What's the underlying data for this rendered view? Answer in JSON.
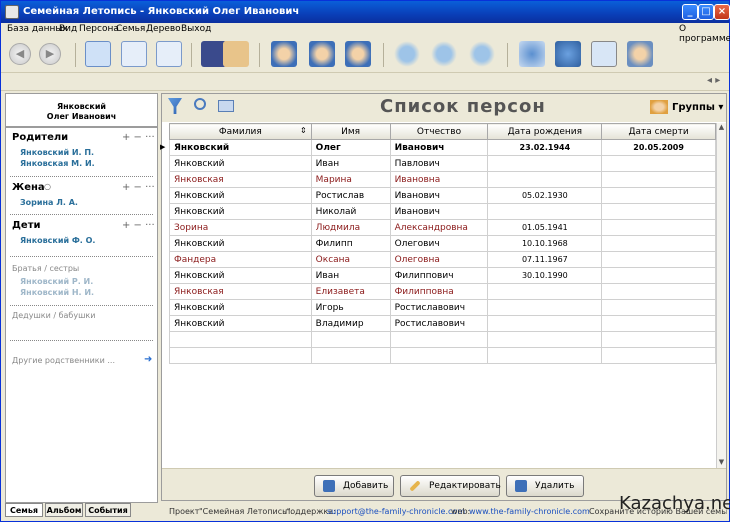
{
  "window": {
    "title": "Семейная Летопись - Янковский Олег Иванович"
  },
  "menu": [
    "База данных",
    "Вид",
    "Персона",
    "Семья",
    "Дерево",
    "Выход"
  ],
  "menu_about": "О программе",
  "left": {
    "person_name": "Янковский",
    "person_given": "Олег Иванович",
    "parents_label": "Родители",
    "parents": [
      "Янковский И. П.",
      "Янковская М. И."
    ],
    "wife_label": "Жена",
    "wife": [
      "Зорина Л. А."
    ],
    "children_label": "Дети",
    "children": [
      "Янковский Ф. О."
    ],
    "siblings_label": "Братья / сестры",
    "siblings": [
      "Янковский Р. И.",
      "Янковский Н. И."
    ],
    "grandparents_label": "Дедушки / бабушки",
    "other_label": "Другие родственники ...",
    "tabs": [
      "Семья",
      "Альбом",
      "События"
    ]
  },
  "main": {
    "title": "Список  персон",
    "groups_label": "Группы",
    "columns": [
      "Фамилия",
      "Имя",
      "Отчество",
      "Дата рождения",
      "Дата смерти"
    ],
    "rows": [
      [
        "Янковский",
        "Олег",
        "Иванович",
        "23.02.1944",
        "20.05.2009"
      ],
      [
        "Янковский",
        "Иван",
        "Павлович",
        "",
        ""
      ],
      [
        "Янковская",
        "Марина",
        "Ивановна",
        "",
        ""
      ],
      [
        "Янковский",
        "Ростислав",
        "Иванович",
        "05.02.1930",
        ""
      ],
      [
        "Янковский",
        "Николай",
        "Иванович",
        "",
        ""
      ],
      [
        "Зорина",
        "Людмила",
        "Александровна",
        "01.05.1941",
        ""
      ],
      [
        "Янковский",
        "Филипп",
        "Олегович",
        "10.10.1968",
        ""
      ],
      [
        "Фандера",
        "Оксана",
        "Олеговна",
        "07.11.1967",
        ""
      ],
      [
        "Янковский",
        "Иван",
        "Филиппович",
        "30.10.1990",
        ""
      ],
      [
        "Янковская",
        "Елизавета",
        "Филипповна",
        "",
        ""
      ],
      [
        "Янковский",
        "Игорь",
        "Ростиславович",
        "",
        ""
      ],
      [
        "Янковский",
        "Владимир",
        "Ростиславович",
        "",
        ""
      ]
    ],
    "female_rows": [
      2,
      5,
      7,
      9
    ],
    "buttons": {
      "add": "Добавить",
      "edit": "Редактировать",
      "delete": "Удалить"
    }
  },
  "status": {
    "project_label": "Проект",
    "project": "\"Семейная Летопись\".",
    "support_label": "поддержка:",
    "support": "support@the-family-chronicle.com",
    "web_label": "web:",
    "web": "www.the-family-chronicle.com",
    "slogan": "Сохраните историю Вашей семьи для по"
  },
  "watermark": "Kazachya.net",
  "colors": {
    "accent": "#0a3fb8",
    "female": "#8b1a1a",
    "link": "#2a6f9a"
  }
}
